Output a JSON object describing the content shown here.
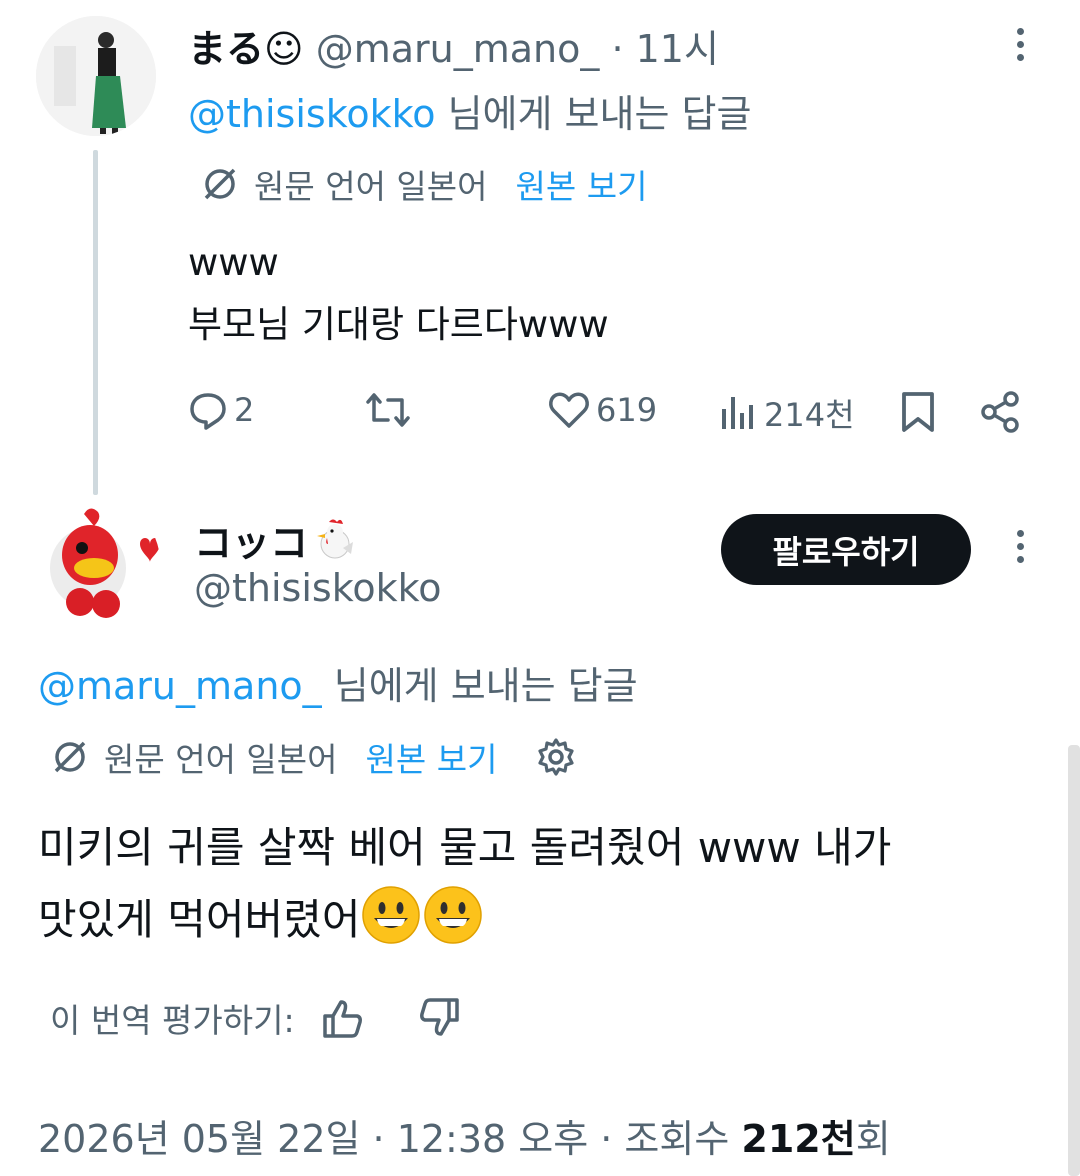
{
  "reply_tweet": {
    "display_name": "まる☺",
    "handle": "@maru_mano_",
    "time": "· 11시",
    "reply_to_prefix": "@thisiskokko",
    "reply_to_suffix": " 님에게 보내는 답글",
    "translation_note": "원문 언어 일본어",
    "view_original": "원본 보기",
    "body_lines": [
      "www",
      "부모님 기대랑 다르다www"
    ],
    "actions": {
      "replies": "2",
      "retweets": "",
      "likes": "619",
      "views": "214천"
    }
  },
  "main_tweet": {
    "display_name": "コッコ",
    "handle": "@thisiskokko",
    "follow_label": "팔로우하기",
    "reply_to_prefix": "@maru_mano_",
    "reply_to_suffix": " 님에게 보내는 답글",
    "translation_note": "원문 언어 일본어",
    "view_original": "원본 보기",
    "body_line1": "미키의 귀를 살짝 베어 물고 돌려줬어 www 내가",
    "body_line2": "맛있게 먹어버렸어",
    "rate_translation": "이 번역 평가하기:",
    "timestamp": "2026년 05월 22일 · 12:38 오후 · 조회수 ",
    "view_count": "212천",
    "view_unit": "회"
  },
  "colors": {
    "accent": "#1d9bf0",
    "text": "#0f1419",
    "secondary": "#536471",
    "thread_line": "#cfd9de"
  }
}
